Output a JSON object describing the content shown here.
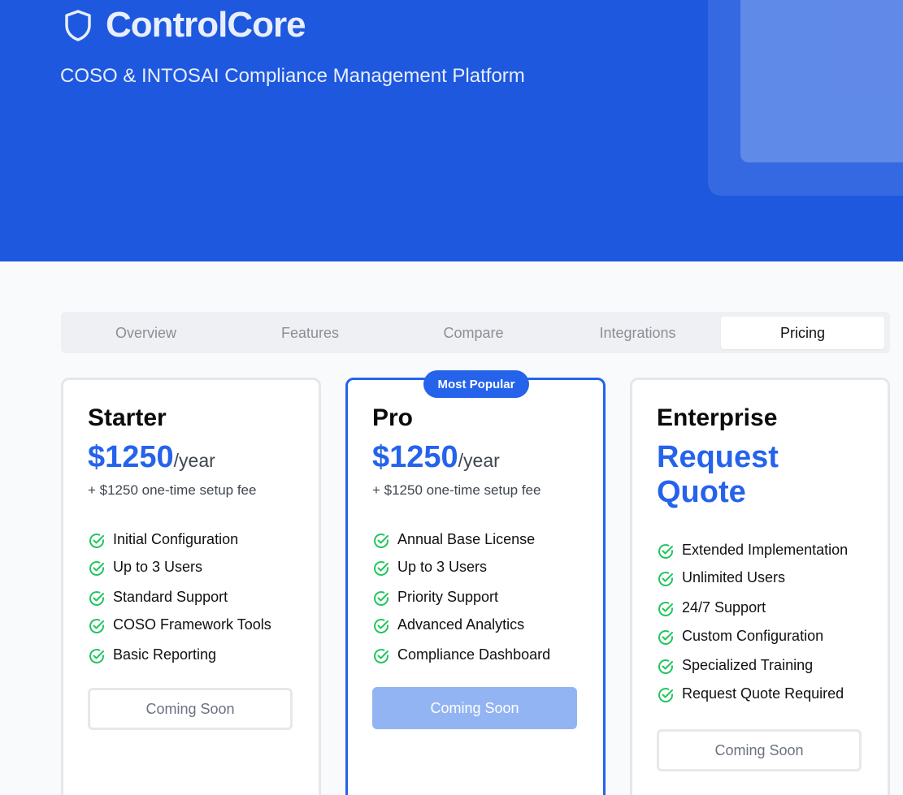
{
  "brand": {
    "name": "ControlCore",
    "tagline": "COSO & INTOSAI Compliance Management Platform",
    "icon": "shield-icon"
  },
  "colors": {
    "hero": "#1e58de",
    "accent": "#2563eb",
    "check": "#22c55e",
    "page_bg": "#f8fafc"
  },
  "tabs": [
    {
      "label": "Overview",
      "active": false
    },
    {
      "label": "Features",
      "active": false
    },
    {
      "label": "Compare",
      "active": false
    },
    {
      "label": "Integrations",
      "active": false
    },
    {
      "label": "Pricing",
      "active": true
    }
  ],
  "plans": [
    {
      "name": "Starter",
      "price": "$1250",
      "period": "/year",
      "fee": "+ $1250 one-time setup fee",
      "features": [
        "Initial Configuration",
        "Up to 3 Users",
        "Standard Support",
        "COSO Framework Tools",
        "Basic Reporting"
      ],
      "button": "Coming Soon"
    },
    {
      "name": "Pro",
      "badge": "Most Popular",
      "price": "$1250",
      "period": "/year",
      "fee": "+ $1250 one-time setup fee",
      "features": [
        "Annual Base License",
        "Up to 3 Users",
        "Priority Support",
        "Advanced Analytics",
        "Compliance Dashboard"
      ],
      "button": "Coming Soon"
    },
    {
      "name": "Enterprise",
      "quote_line1": "Request",
      "quote_line2": "Quote",
      "features": [
        "Extended Implementation",
        "Unlimited Users",
        "24/7 Support",
        "Custom Configuration",
        "Specialized Training",
        "Request Quote Required"
      ],
      "button": "Coming Soon"
    }
  ]
}
